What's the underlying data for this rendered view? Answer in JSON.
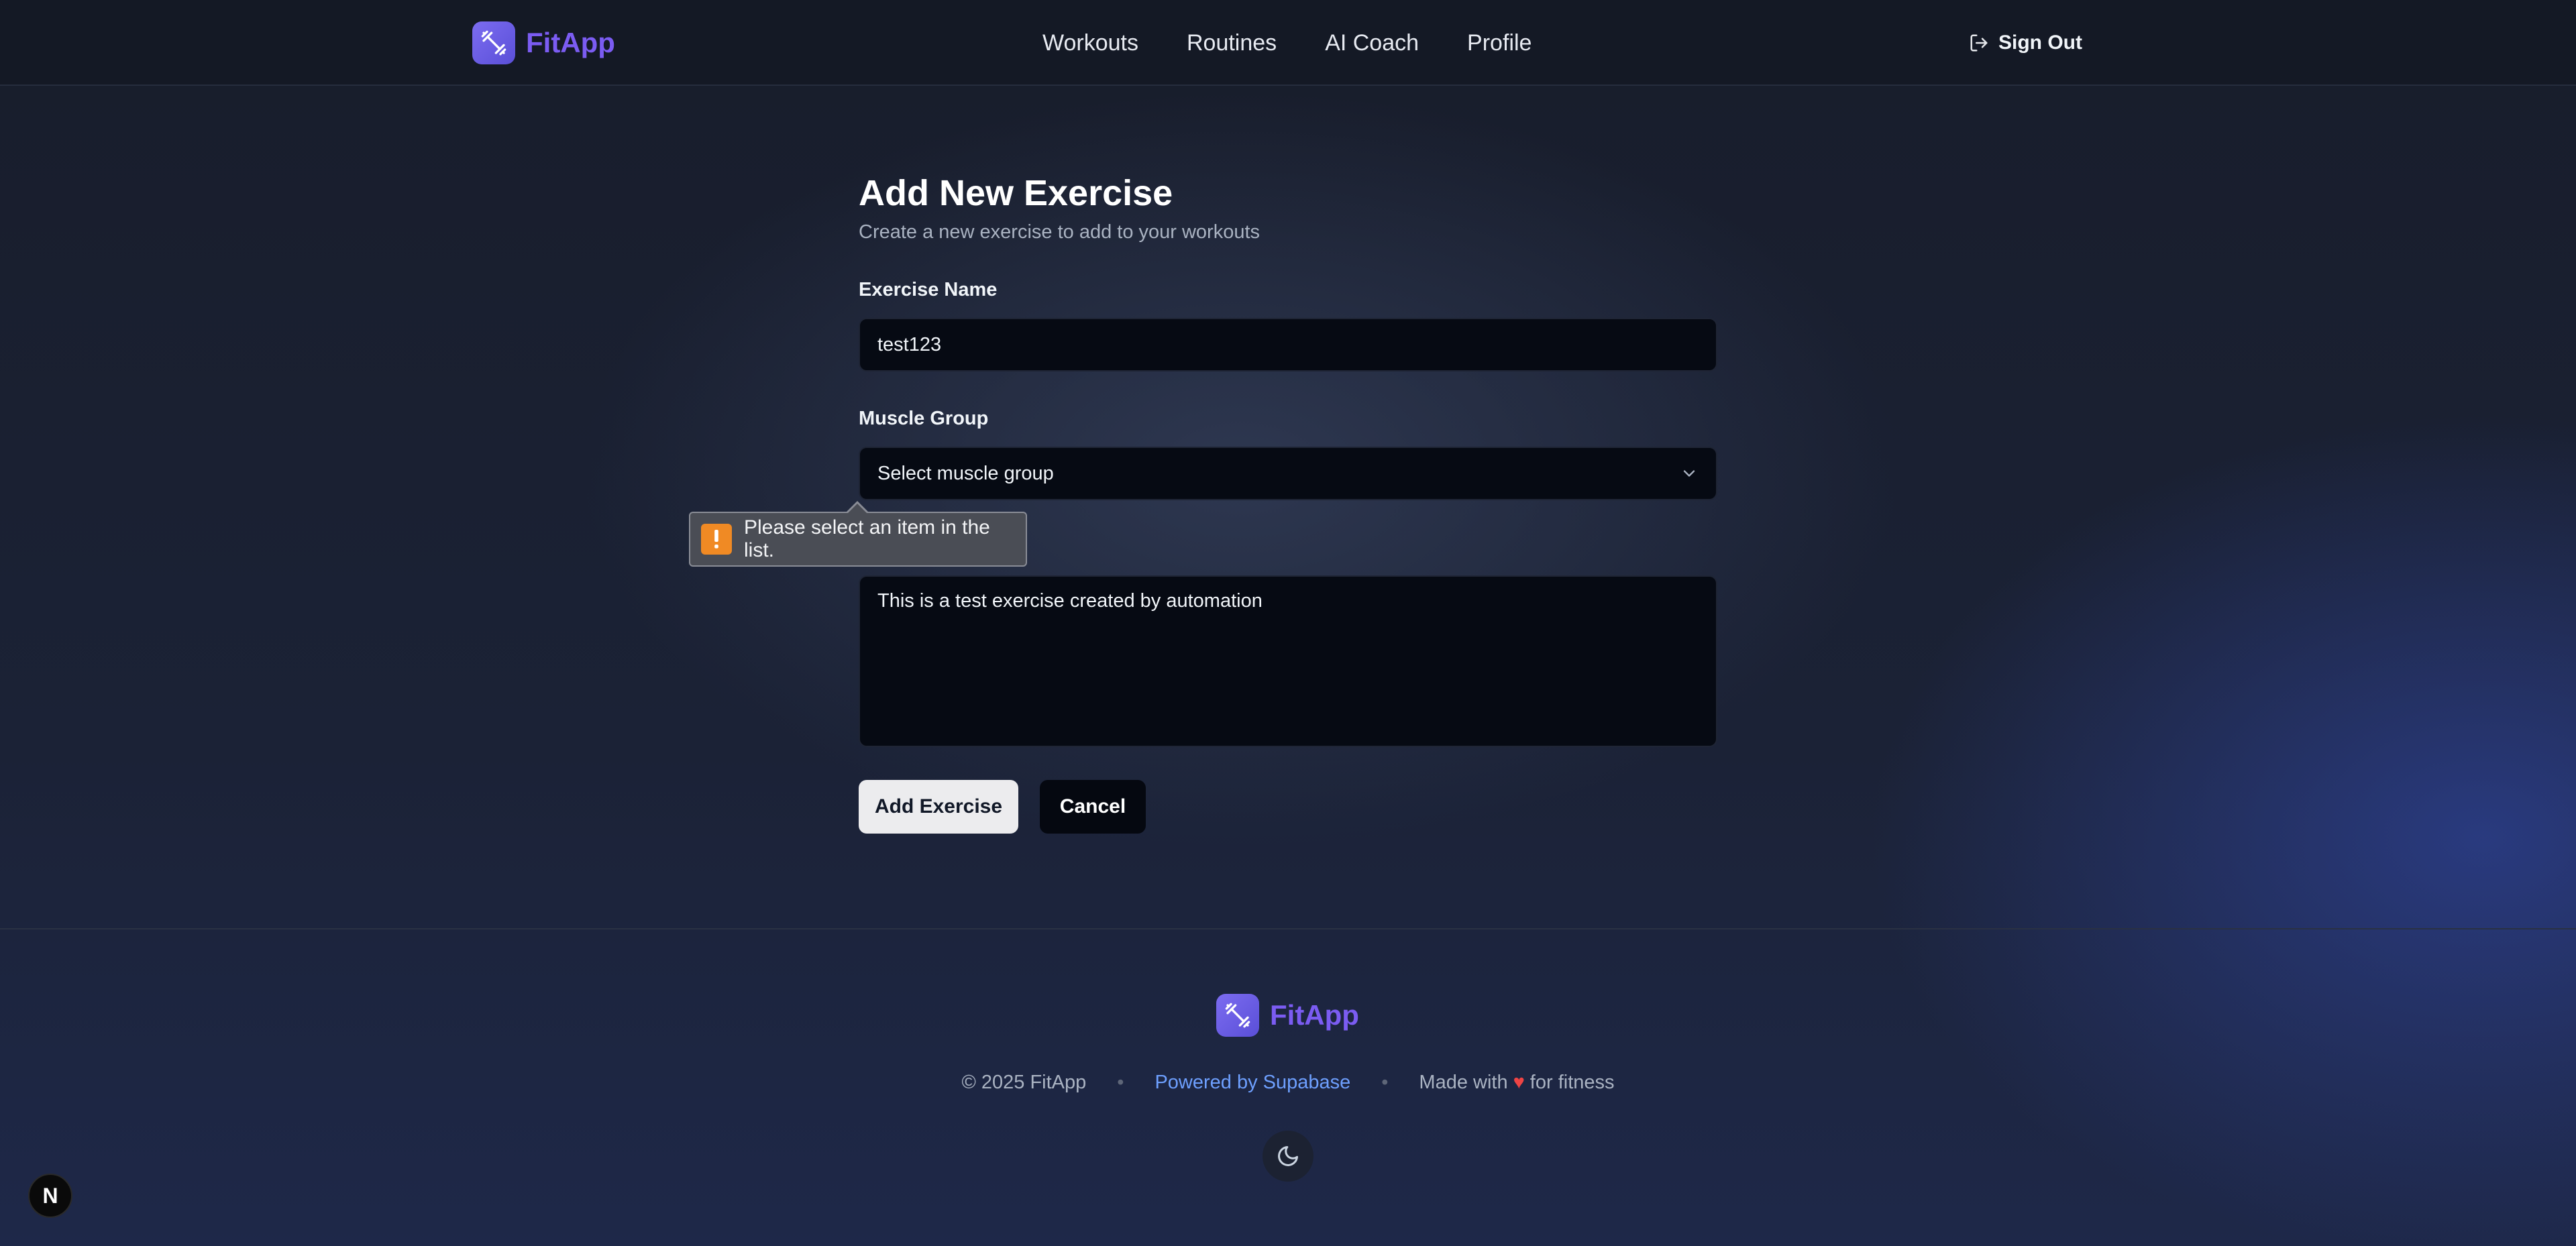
{
  "header": {
    "brand": "FitApp",
    "nav": [
      {
        "label": "Workouts"
      },
      {
        "label": "Routines"
      },
      {
        "label": "AI Coach"
      },
      {
        "label": "Profile"
      }
    ],
    "sign_out_label": "Sign Out"
  },
  "form": {
    "title": "Add New Exercise",
    "subtitle": "Create a new exercise to add to your workouts",
    "name_label": "Exercise Name",
    "name_value": "test123",
    "muscle_label": "Muscle Group",
    "muscle_selected": "Select muscle group",
    "description_value": "This is a test exercise created by automation",
    "submit_label": "Add Exercise",
    "cancel_label": "Cancel"
  },
  "tooltip": {
    "message": "Please select an item in the list."
  },
  "footer": {
    "brand": "FitApp",
    "copyright": "© 2025 FitApp",
    "powered_by": "Powered by Supabase",
    "made_with_prefix": "Made with",
    "made_with_suffix": "for fitness",
    "separator": "•"
  },
  "badge": {
    "letter": "N"
  },
  "icons": {
    "logo": "dumbbell-icon",
    "sign_out": "log-out-icon",
    "select": "chevron-down-icon",
    "warning": "exclamation-icon",
    "heart": "heart-icon",
    "theme": "moon-icon"
  },
  "colors": {
    "brand": "#7b5cf2",
    "link": "#6ea0ff",
    "warning": "#f08a24",
    "heart": "#ef4444"
  }
}
